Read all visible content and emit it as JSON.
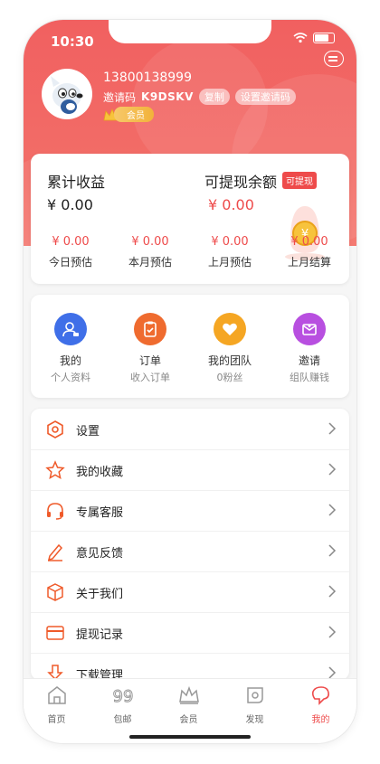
{
  "status": {
    "time": "10:30"
  },
  "profile": {
    "phone": "13800138999",
    "invite_label": "邀请码",
    "invite_code": "K9DSKV",
    "copy_label": "复制",
    "set_invite_label": "设置邀请码",
    "vip_label": "会员"
  },
  "earnings": {
    "total_label": "累计收益",
    "total_value": "¥ 0.00",
    "withdrawable_label": "可提现余额",
    "withdrawable_tag": "可提现",
    "withdrawable_value": "¥ 0.00",
    "estimates": [
      {
        "value": "¥ 0.00",
        "label": "今日预估"
      },
      {
        "value": "¥ 0.00",
        "label": "本月预估"
      },
      {
        "value": "¥ 0.00",
        "label": "上月预估"
      },
      {
        "value": "¥ 0.00",
        "label": "上月结算"
      }
    ]
  },
  "quick_actions": [
    {
      "title": "我的",
      "subtitle": "个人资料",
      "icon": "profile-icon",
      "color": "#3f6fe8"
    },
    {
      "title": "订单",
      "subtitle": "收入订单",
      "icon": "order-icon",
      "color": "#ef6b2f"
    },
    {
      "title": "我的团队",
      "subtitle": "0粉丝",
      "icon": "team-icon",
      "color": "#f5a623"
    },
    {
      "title": "邀请",
      "subtitle": "组队赚钱",
      "icon": "invite-icon",
      "color": "#b84fe0"
    }
  ],
  "menu": [
    {
      "label": "设置",
      "icon": "settings-icon"
    },
    {
      "label": "我的收藏",
      "icon": "star-icon"
    },
    {
      "label": "专属客服",
      "icon": "headset-icon"
    },
    {
      "label": "意见反馈",
      "icon": "pencil-icon"
    },
    {
      "label": "关于我们",
      "icon": "box-icon"
    },
    {
      "label": "提现记录",
      "icon": "card-icon"
    },
    {
      "label": "下载管理",
      "icon": "download-icon"
    }
  ],
  "tabs": [
    {
      "label": "首页",
      "icon": "home-icon",
      "active": false
    },
    {
      "label": "包邮",
      "icon": "free-shipping-icon",
      "active": false
    },
    {
      "label": "会员",
      "icon": "crown-icon",
      "active": false
    },
    {
      "label": "发现",
      "icon": "discover-icon",
      "active": false
    },
    {
      "label": "我的",
      "icon": "mine-icon",
      "active": true
    }
  ],
  "colors": {
    "primary": "#f16060",
    "accent": "#ee4b4b",
    "vip": "#f2b23a"
  }
}
